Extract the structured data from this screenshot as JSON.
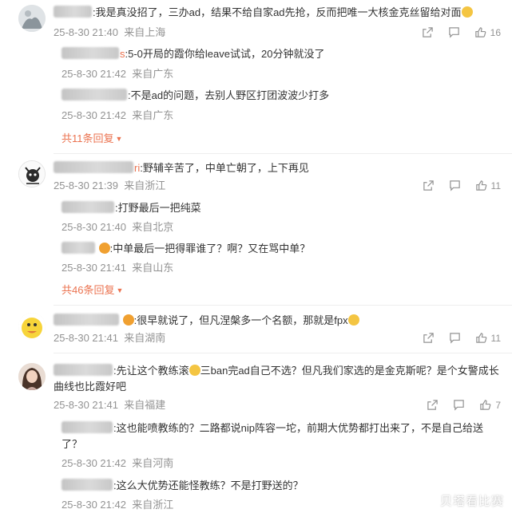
{
  "icons": {
    "forward": "forward-icon",
    "comment": "comment-icon",
    "like": "thumbs-up-icon"
  },
  "colors": {
    "accent": "#eb7350",
    "meta": "#939393",
    "text": "#333333"
  },
  "comments": [
    {
      "text": ":我是真没招了，三办ad，结果不给自家ad先抢，反而把唯一大核金克丝留给对面",
      "time": "25-8-30 21:40",
      "location": "来自上海",
      "likes": "16",
      "replies": [
        {
          "name_suffix": "s",
          "text": ":5-0开局的霞你给leave试试，20分钟就没了",
          "time": "25-8-30 21:42",
          "location": "来自广东"
        },
        {
          "text": ":不是ad的问题，去别人野区打团波波少打多",
          "time": "25-8-30 21:42",
          "location": "来自广东"
        }
      ],
      "more": "共11条回复"
    },
    {
      "name_suffix": "ri",
      "text": ":野辅辛苦了，中单亡朝了，上下再见",
      "time": "25-8-30 21:39",
      "location": "来自浙江",
      "likes": "11",
      "replies": [
        {
          "text": ":打野最后一把纯菜",
          "time": "25-8-30 21:40",
          "location": "来自北京"
        },
        {
          "text": ":中单最后一把得罪谁了？啊？又在骂中单？",
          "time": "25-8-30 21:41",
          "location": "来自山东"
        }
      ],
      "more": "共46条回复"
    },
    {
      "text": ":很早就说了，但凡涅槃多一个名额，那就是fpx",
      "time": "25-8-30 21:41",
      "location": "来自湖南",
      "likes": "11"
    },
    {
      "text_a": ":先让这个教练滚",
      "text_b": "三ban完ad自己不选？但凡我们家选的是金克斯呢？是个女警成长曲线也比霞好吧",
      "time": "25-8-30 21:41",
      "location": "来自福建",
      "likes": "7",
      "replies": [
        {
          "text": ":这也能喷教练的？二路都说nip阵容一坨，前期大优势都打出来了，不是自己给送了？",
          "time": "25-8-30 21:42",
          "location": "来自河南"
        },
        {
          "text": ":这么大优势还能怪教练？不是打野送的？",
          "time": "25-8-30 21:42",
          "location": "来自浙江"
        }
      ]
    }
  ],
  "watermark": "贝塔看比赛"
}
